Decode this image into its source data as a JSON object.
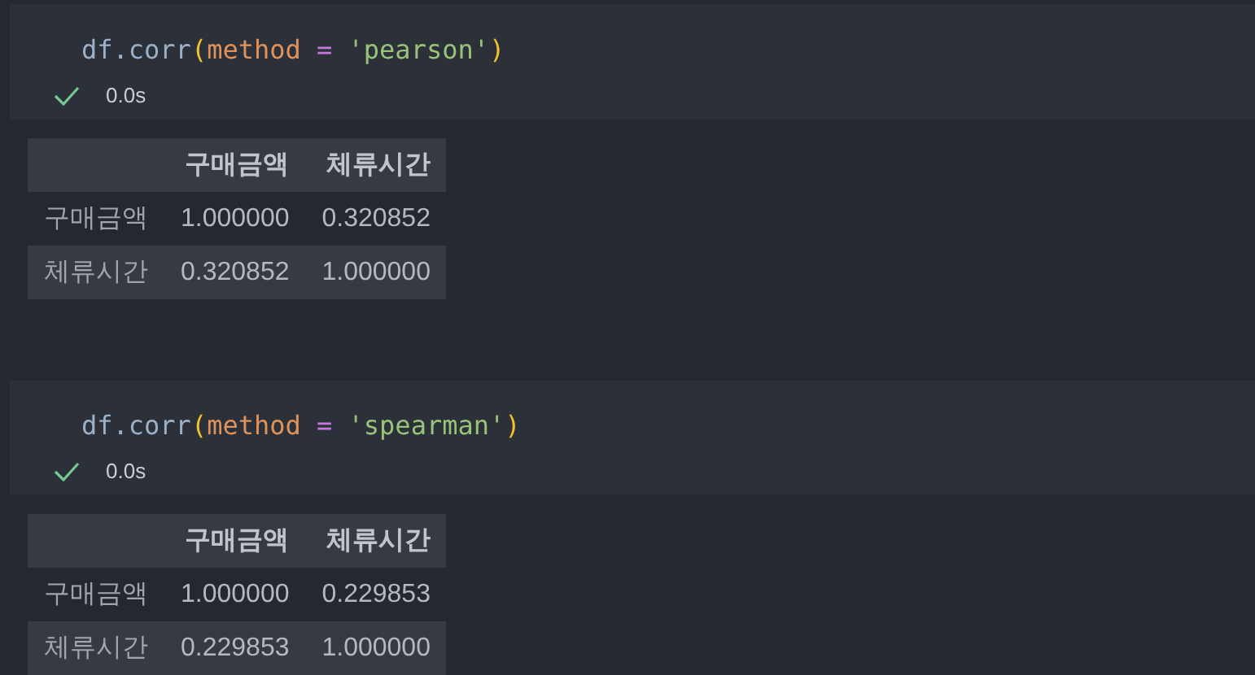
{
  "cells": [
    {
      "code": [
        {
          "kind": "plain",
          "text": "df.corr"
        },
        {
          "kind": "paren",
          "text": "("
        },
        {
          "kind": "param",
          "text": "method"
        },
        {
          "kind": "operator",
          "text": " = "
        },
        {
          "kind": "string",
          "text": "'pearson'"
        },
        {
          "kind": "paren",
          "text": ")"
        }
      ],
      "status": {
        "success": true,
        "time": "0.0s"
      },
      "table": {
        "columns": [
          "",
          "구매금액",
          "체류시간"
        ],
        "rows": [
          [
            "구매금액",
            "1.000000",
            "0.320852"
          ],
          [
            "체류시간",
            "0.320852",
            "1.000000"
          ]
        ]
      }
    },
    {
      "code": [
        {
          "kind": "plain",
          "text": "df.corr"
        },
        {
          "kind": "paren",
          "text": "("
        },
        {
          "kind": "param",
          "text": "method"
        },
        {
          "kind": "operator",
          "text": " = "
        },
        {
          "kind": "string",
          "text": "'spearman'"
        },
        {
          "kind": "paren",
          "text": ")"
        }
      ],
      "status": {
        "success": true,
        "time": "0.0s"
      },
      "table": {
        "columns": [
          "",
          "구매금액",
          "체류시간"
        ],
        "rows": [
          [
            "구매금액",
            "1.000000",
            "0.229853"
          ],
          [
            "체류시간",
            "0.229853",
            "1.000000"
          ]
        ]
      }
    }
  ]
}
